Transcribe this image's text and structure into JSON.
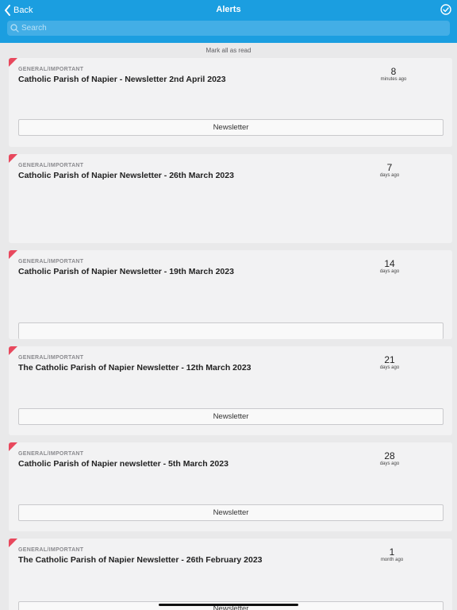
{
  "header": {
    "back_label": "Back",
    "title": "Alerts",
    "search_placeholder": "Search"
  },
  "mark_all_label": "Mark all as read",
  "colors": {
    "header": "#1b9ee0",
    "flag": "#e8485d"
  },
  "alerts": [
    {
      "category": "GENERAL/IMPORTANT",
      "title": "Catholic Parish of Napier - Newsletter 2nd April 2023",
      "time_num": "8",
      "time_unit": "minutes ago",
      "attachment": "Newsletter"
    },
    {
      "category": "GENERAL/IMPORTANT",
      "title": "Catholic Parish of Napier Newsletter - 26th March 2023",
      "time_num": "7",
      "time_unit": "days ago",
      "attachment": ""
    },
    {
      "category": "GENERAL/IMPORTANT",
      "title": "Catholic Parish of Napier Newsletter - 19th March 2023",
      "time_num": "14",
      "time_unit": "days ago",
      "attachment": ""
    },
    {
      "category": "GENERAL/IMPORTANT",
      "title": "The Catholic Parish of Napier Newsletter - 12th March 2023",
      "time_num": "21",
      "time_unit": "days ago",
      "attachment": "Newsletter"
    },
    {
      "category": "GENERAL/IMPORTANT",
      "title": "Catholic Parish of Napier newsletter - 5th March 2023",
      "time_num": "28",
      "time_unit": "days ago",
      "attachment": "Newsletter"
    },
    {
      "category": "GENERAL/IMPORTANT",
      "title": "The Catholic Parish of Napier Newsletter - 26th February 2023",
      "time_num": "1",
      "time_unit": "month ago",
      "attachment": "Newsletter"
    }
  ]
}
